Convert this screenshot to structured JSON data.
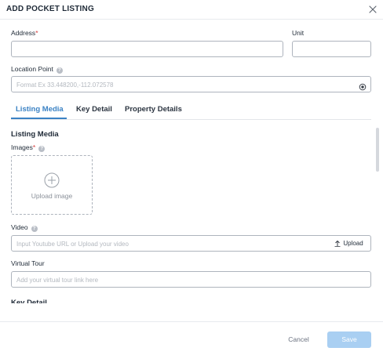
{
  "header": {
    "title": "ADD POCKET LISTING",
    "close_icon": "close-icon"
  },
  "address": {
    "label": "Address",
    "required_mark": "*",
    "value": "",
    "placeholder": ""
  },
  "unit": {
    "label": "Unit",
    "value": "",
    "placeholder": ""
  },
  "location": {
    "label": "Location Point",
    "value": "",
    "placeholder": "Format Ex 33.448200,-112.072578",
    "icon": "target-icon"
  },
  "tabs": [
    {
      "label": "Listing Media",
      "active": true
    },
    {
      "label": "Key Detail",
      "active": false
    },
    {
      "label": "Property Details",
      "active": false
    }
  ],
  "listing_media": {
    "title": "Listing Media",
    "images_label": "Images",
    "images_required": "*",
    "upload_image_label": "Upload image",
    "video_label": "Video",
    "video_placeholder": "Input Youtube URL or Upload your video",
    "upload_button_label": "Upload",
    "virtual_tour_label": "Virtual Tour",
    "virtual_tour_placeholder": "Add your virtual tour link here"
  },
  "next_section_title": "Key Detail",
  "footer": {
    "cancel_label": "Cancel",
    "save_label": "Save"
  },
  "colors": {
    "accent": "#3b82c4",
    "save_disabled": "#a9cff2",
    "required": "#d63b3b"
  }
}
